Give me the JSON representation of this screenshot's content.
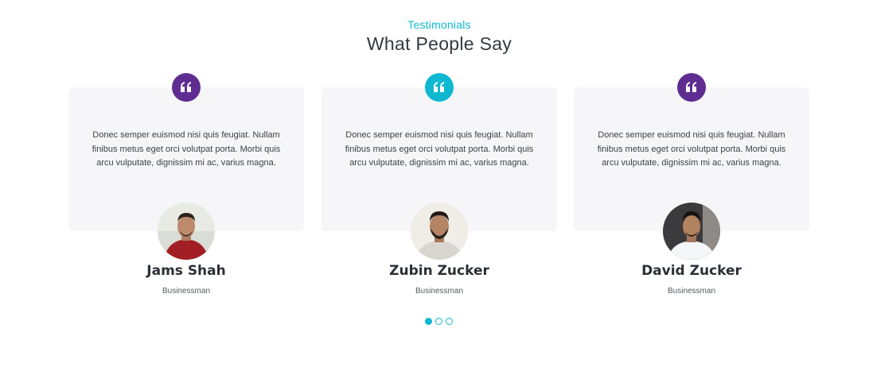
{
  "header": {
    "eyebrow": "Testimonials",
    "title": "What People Say"
  },
  "colors": {
    "accent": "#0fb8d1",
    "purple": "#5f2d91",
    "card_bg": "#f6f6f8"
  },
  "testimonials": [
    {
      "quote_icon": "quote-icon",
      "badge_color": "#5f2d91",
      "text": "Donec semper euismod nisi quis feugiat. Nullam finibus metus eget orci volutpat porta. Morbi quis arcu vulputate, dignissim mi ac, varius magna.",
      "name": "Jams Shah",
      "role": "Businessman"
    },
    {
      "quote_icon": "quote-icon",
      "badge_color": "#0fb8d1",
      "text": "Donec semper euismod nisi quis feugiat. Nullam finibus metus eget orci volutpat porta. Morbi quis arcu vulputate, dignissim mi ac, varius magna.",
      "name": "Zubin Zucker",
      "role": "Businessman"
    },
    {
      "quote_icon": "quote-icon",
      "badge_color": "#5f2d91",
      "text": "Donec semper euismod nisi quis feugiat. Nullam finibus metus eget orci volutpat porta. Morbi quis arcu vulputate, dignissim mi ac, varius magna.",
      "name": "David Zucker",
      "role": "Businessman"
    }
  ],
  "carousel": {
    "active_index": 0
  }
}
